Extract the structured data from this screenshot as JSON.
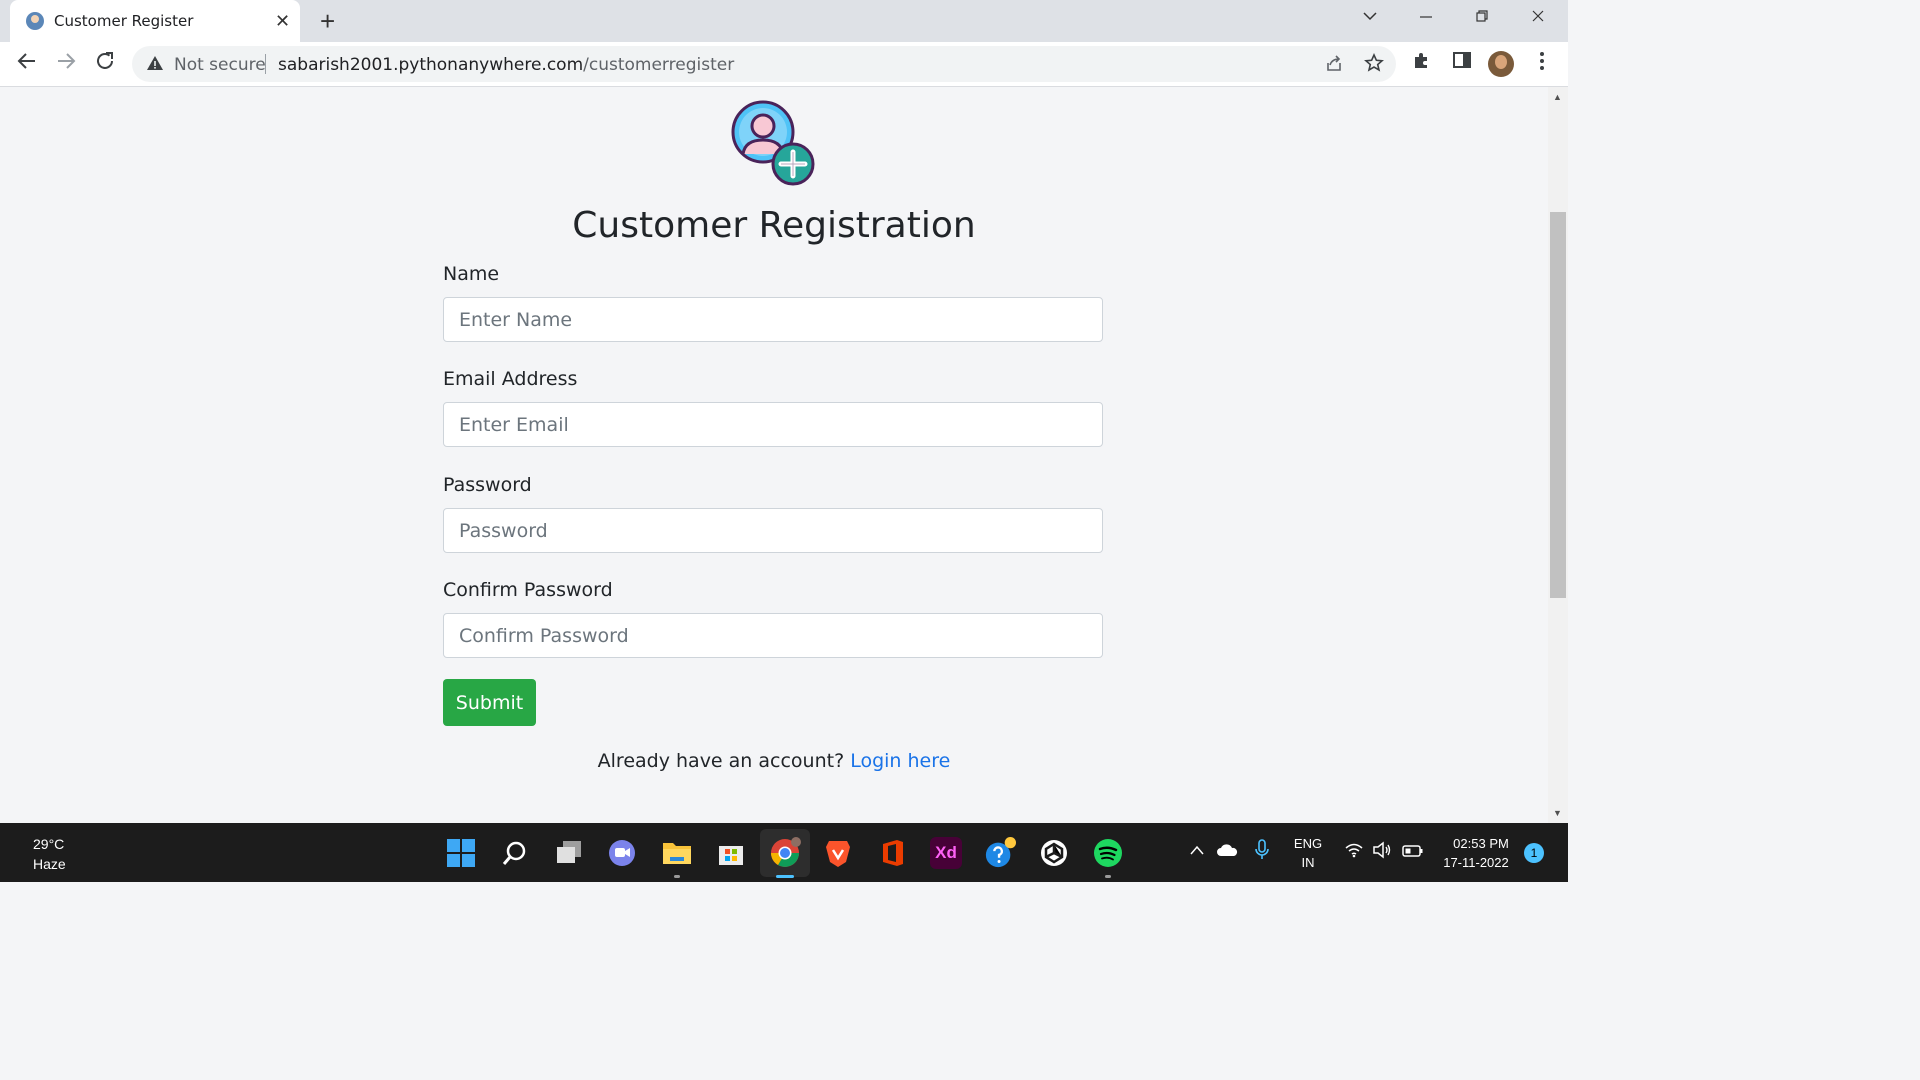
{
  "browser": {
    "tab_title": "Customer Register",
    "tab_close": "✕",
    "new_tab": "+",
    "security_label": "Not secure",
    "url_domain": "sabarish2001.pythonanywhere.com",
    "url_path": "/customerregister"
  },
  "page": {
    "title": "Customer Registration",
    "fields": [
      {
        "label": "Name",
        "placeholder": "Enter Name",
        "type": "text"
      },
      {
        "label": "Email Address",
        "placeholder": "Enter Email",
        "type": "email"
      },
      {
        "label": "Password",
        "placeholder": "Password",
        "type": "password"
      },
      {
        "label": "Confirm Password",
        "placeholder": "Confirm Password",
        "type": "password"
      }
    ],
    "submit_label": "Submit",
    "login_prompt": "Already have an account?",
    "login_link": "Login here"
  },
  "taskbar": {
    "temperature": "29°C",
    "weather": "Haze",
    "language": "ENG",
    "region": "IN",
    "time": "02:53 PM",
    "date": "17-11-2022",
    "notification_count": "1",
    "apps": [
      "start-icon",
      "search-icon",
      "task-view-icon",
      "teams-chat-icon",
      "file-explorer-icon",
      "microsoft-store-icon",
      "chrome-icon",
      "brave-icon",
      "office-icon",
      "adobe-xd-icon",
      "get-help-icon",
      "unity-hub-icon",
      "spotify-icon"
    ]
  },
  "colors": {
    "submit": "#28a745",
    "link": "#1a73e8",
    "page_bg": "#f4f5f7",
    "icon_circle": "#4fc3f7",
    "icon_plus": "#26a69a"
  }
}
